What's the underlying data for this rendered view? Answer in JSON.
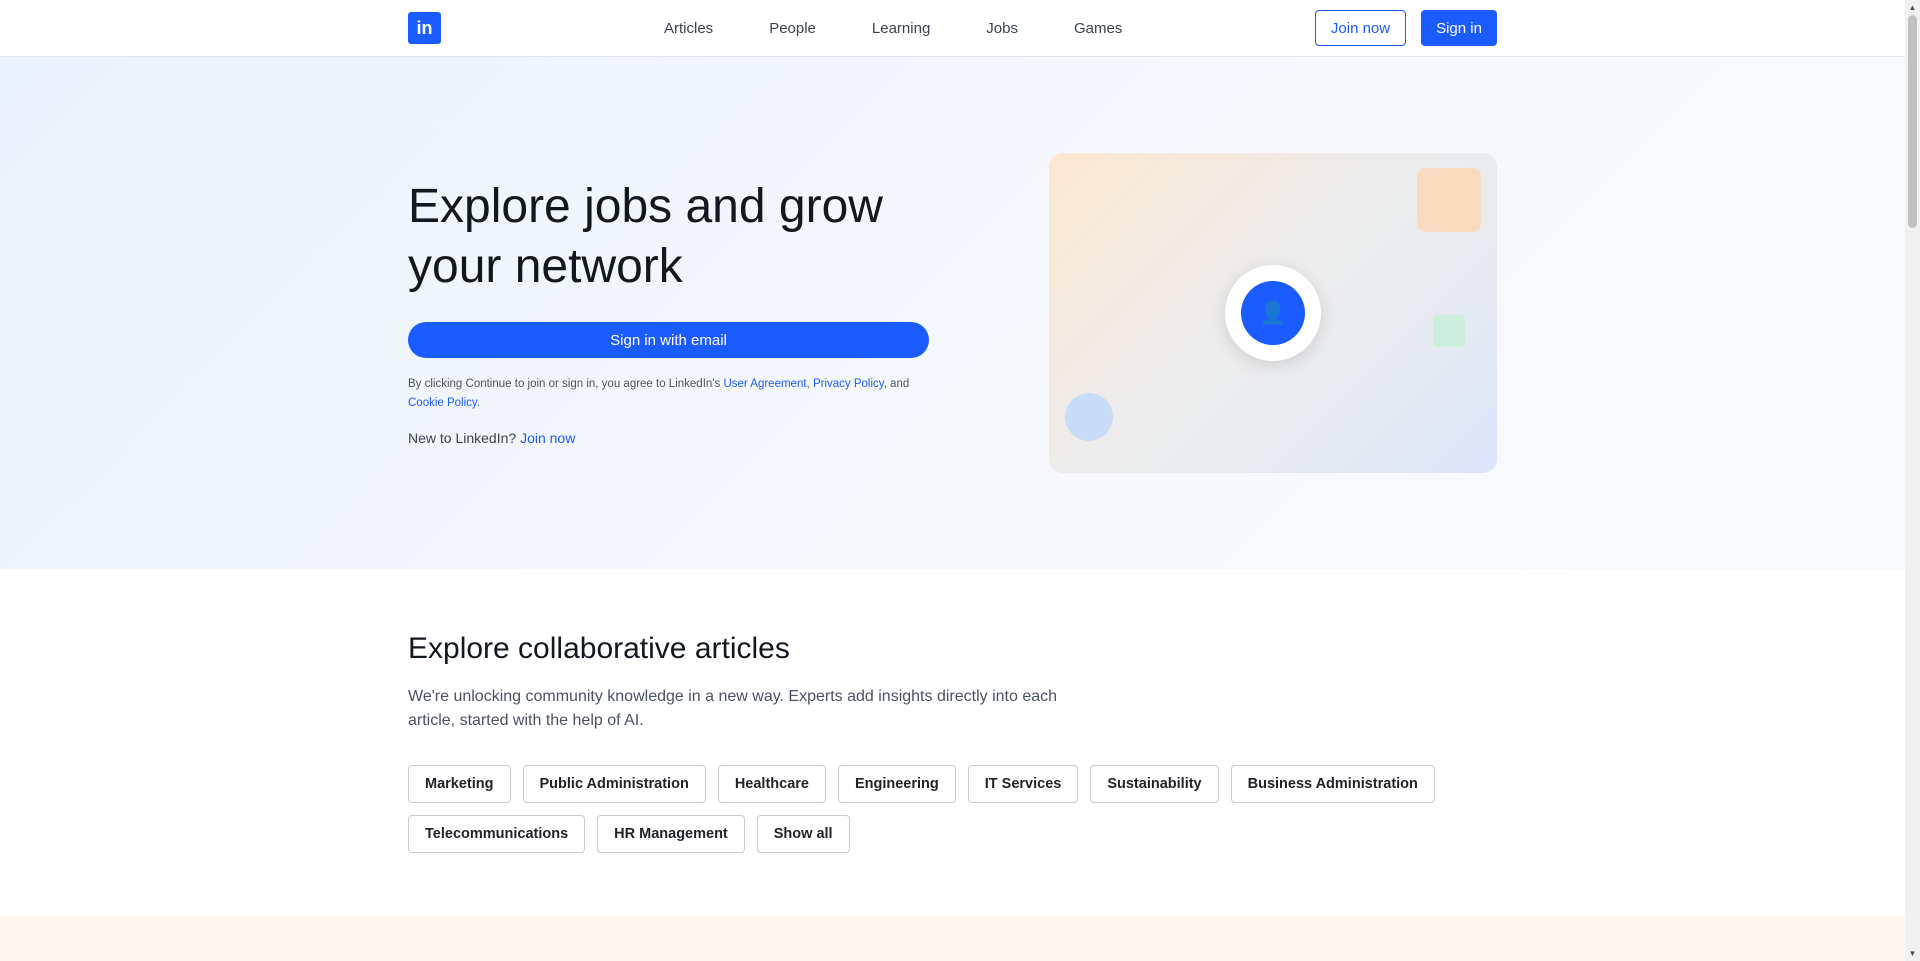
{
  "header": {
    "logo_text": "in",
    "nav": [
      "Articles",
      "People",
      "Learning",
      "Jobs",
      "Games"
    ],
    "join_label": "Join now",
    "signin_label": "Sign in"
  },
  "hero": {
    "title": "Explore jobs and grow your network",
    "email_button": "Sign in with email",
    "legal_prefix": "By clicking Continue to join or sign in, you agree to LinkedIn's ",
    "legal_user_agreement": "User Agreement",
    "legal_sep1": ", ",
    "legal_privacy": "Privacy Policy",
    "legal_sep2": ", and ",
    "legal_cookie": "Cookie Policy",
    "legal_end": ".",
    "new_prefix": "New to LinkedIn? ",
    "new_join": "Join now",
    "avatar_icon": "person-icon"
  },
  "articles": {
    "title": "Explore collaborative articles",
    "description": "We're unlocking community knowledge in a new way. Experts add insights directly into each article, started with the help of AI.",
    "topics": [
      "Marketing",
      "Public Administration",
      "Healthcare",
      "Engineering",
      "IT Services",
      "Sustainability",
      "Business Administration",
      "Telecommunications",
      "HR Management",
      "Show all"
    ]
  },
  "colors": {
    "accent": "#1a5cff",
    "hero_bg": "#eef4fc",
    "bottom_band": "#fff6ee"
  }
}
